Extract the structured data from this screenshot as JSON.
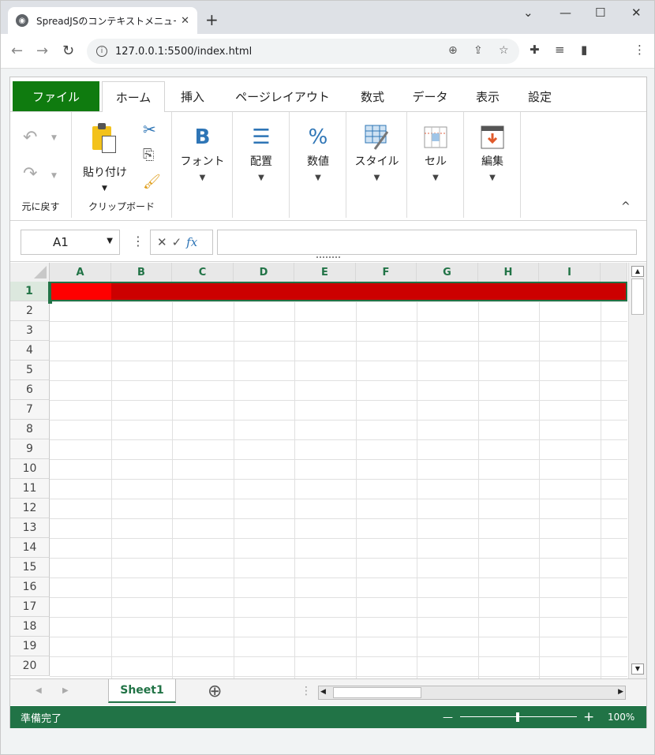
{
  "browser": {
    "tab_title": "SpreadJSのコンテキストメニューのカスタ",
    "tab_close": "✕",
    "new_tab": "+",
    "minimize": "—",
    "maximize": "☐",
    "close": "✕",
    "chevron": "⌄",
    "url": "127.0.0.1:5500/index.html"
  },
  "ribbon": {
    "tabs": [
      "ファイル",
      "ホーム",
      "挿入",
      "ページレイアウト",
      "数式",
      "データ",
      "表示",
      "設定"
    ],
    "undo_label": "元に戻す",
    "paste_label": "貼り付け",
    "clipboard_label": "クリップボード",
    "font_label": "フォント",
    "align_label": "配置",
    "number_label": "数値",
    "style_label": "スタイル",
    "cell_label": "セル",
    "edit_label": "編集",
    "font_icon": "B",
    "number_icon": "%",
    "collapse": "^"
  },
  "formula_bar": {
    "name_box": "A1",
    "fx": "fx",
    "formula": ""
  },
  "grid": {
    "columns": [
      "A",
      "B",
      "C",
      "D",
      "E",
      "F",
      "G",
      "H",
      "I"
    ],
    "rows": [
      "1",
      "2",
      "3",
      "4",
      "5",
      "6",
      "7",
      "8",
      "9",
      "10",
      "11",
      "12",
      "13",
      "14",
      "15",
      "16",
      "17",
      "18",
      "19",
      "20"
    ],
    "selected_row": "1",
    "row1_fill": "#cc0000",
    "a1_fill": "#ff0000"
  },
  "sheets": {
    "active": "Sheet1",
    "add": "⊕"
  },
  "status": {
    "text": "準備完了",
    "zoom": "100%",
    "minus": "—",
    "plus": "+"
  },
  "colors": {
    "accent": "#217346",
    "file_tab": "#0f7b0f"
  }
}
